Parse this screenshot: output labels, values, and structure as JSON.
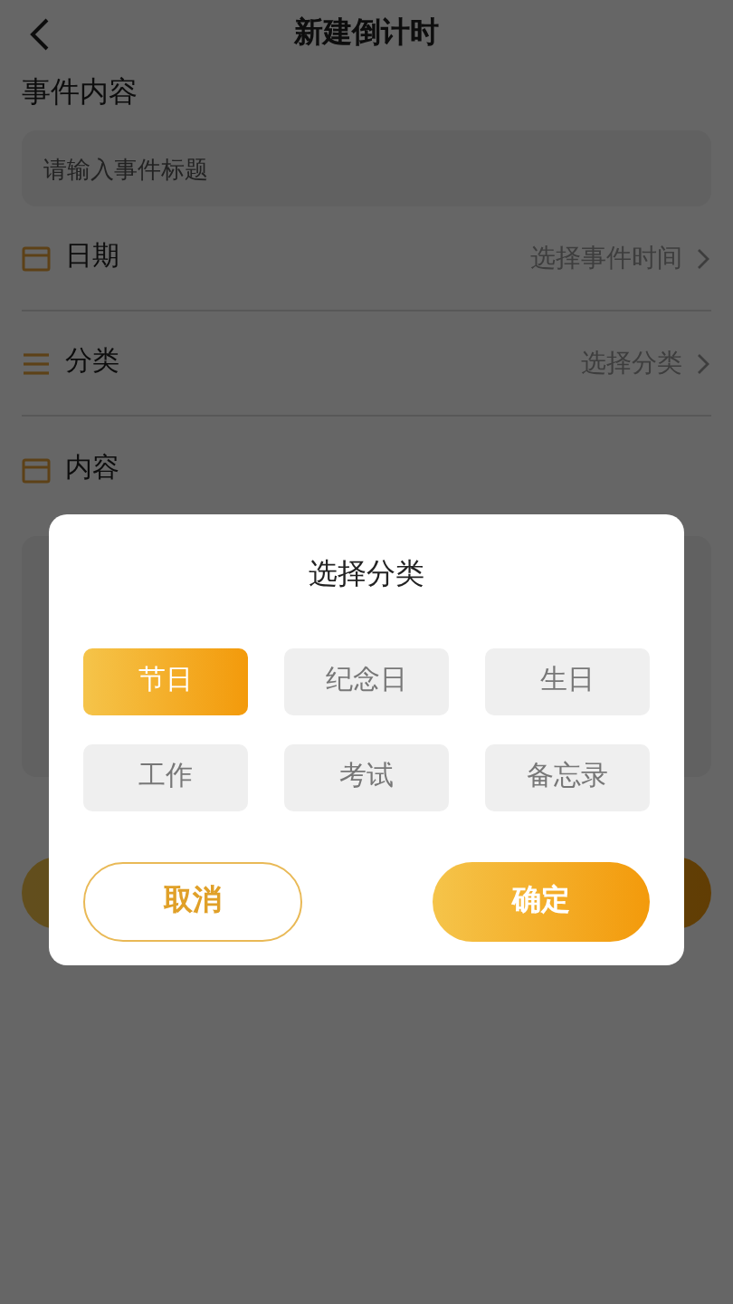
{
  "header": {
    "title": "新建倒计时"
  },
  "section_label": "事件内容",
  "title_field": {
    "placeholder": "请输入事件标题"
  },
  "rows": [
    {
      "kind": "calendar",
      "label": "日期",
      "value": "选择事件时间"
    },
    {
      "kind": "list",
      "label": "分类",
      "value": "选择分类"
    },
    {
      "kind": "calendar",
      "label": "内容"
    }
  ],
  "dialog": {
    "title": "选择分类",
    "options": [
      {
        "label": "节日",
        "selected": true
      },
      {
        "label": "纪念日",
        "selected": false
      },
      {
        "label": "生日",
        "selected": false
      },
      {
        "label": "工作",
        "selected": false
      },
      {
        "label": "考试",
        "selected": false
      },
      {
        "label": "备忘录",
        "selected": false
      }
    ],
    "cancel": "取消",
    "confirm": "确定"
  }
}
